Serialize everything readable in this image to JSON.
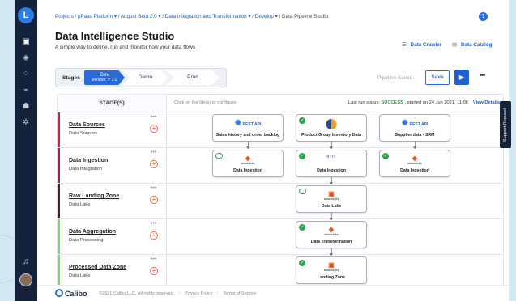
{
  "sidebar": {
    "logo_letter": "L",
    "icons": [
      "monitor-icon",
      "layers-icon",
      "grid-icon",
      "chart-icon",
      "people-icon",
      "gear-icon"
    ],
    "bottom_icons": [
      "bell-icon",
      "avatar"
    ]
  },
  "breadcrumb": {
    "items": [
      "Projects / pPaas Platform ▾",
      "/ August Beta 2.0 ▾",
      "/ Data Integration and Transformation ▾",
      "/ Develop ▾"
    ],
    "current": "/ Data Pipeline Studio"
  },
  "header": {
    "title": "Data Intelligence Studio",
    "subtitle": "A simple way to define, run and monitor how your data flows",
    "links": [
      "Data Crawler",
      "Data Catalog"
    ]
  },
  "stages": {
    "label": "Stages",
    "items": [
      {
        "name": "Dev",
        "version": "Version: V 1.0",
        "active": true
      },
      {
        "name": "Demo"
      },
      {
        "name": "Prod"
      }
    ]
  },
  "toolbar": {
    "status": "Pipeline Saved",
    "save_label": "Save",
    "run_icon": "▶",
    "more": "•••"
  },
  "grid": {
    "stage_header": "STAGE(S)",
    "hint": "Click on the tile(s) to configure",
    "run_prefix": "Last run status:",
    "run_status": "SUCCESS",
    "run_suffix": ", started on 24 Jun 2021, 11:06",
    "view_details": "View Details",
    "rows": [
      {
        "name": "Data Sources",
        "sub": "Data Sources",
        "color": "#d0223f"
      },
      {
        "name": "Data Ingestion",
        "sub": "Data Integration",
        "color": "#a3204a"
      },
      {
        "name": "Raw Landing Zone",
        "sub": "Data Lake",
        "color": "#4a1f22"
      },
      {
        "name": "Data Aggregation",
        "sub": "Data Processing",
        "color": "#7ed37a"
      },
      {
        "name": "Processed Data Zone",
        "sub": "Data Lake",
        "color": "#7ed37a"
      }
    ],
    "nodes": {
      "n1": {
        "label": "Sales history and order backlog",
        "logo": "REST API"
      },
      "n2": {
        "label": "Product Group Inventory Data"
      },
      "n3": {
        "label": "Supplier data - SRM",
        "logo": "REST API"
      },
      "n4": {
        "label": "Data Ingestion",
        "logo": "databricks"
      },
      "n5": {
        "label": "Data Ingestion",
        "logo": "nifi"
      },
      "n6": {
        "label": "Data Ingestion",
        "logo": "databricks"
      },
      "n7": {
        "label": "Data Lake",
        "logo": "amazon S3"
      },
      "n8": {
        "label": "Data Transformation",
        "logo": "databricks"
      },
      "n9": {
        "label": "Landing Zone",
        "logo": "amazon S3"
      }
    }
  },
  "footer": {
    "brand": "Calibo",
    "copyright": "©2021 Calibo LLC. All rights reserved.",
    "links": [
      "Privacy Policy",
      "Terms of Service"
    ]
  },
  "support": "Support Request"
}
